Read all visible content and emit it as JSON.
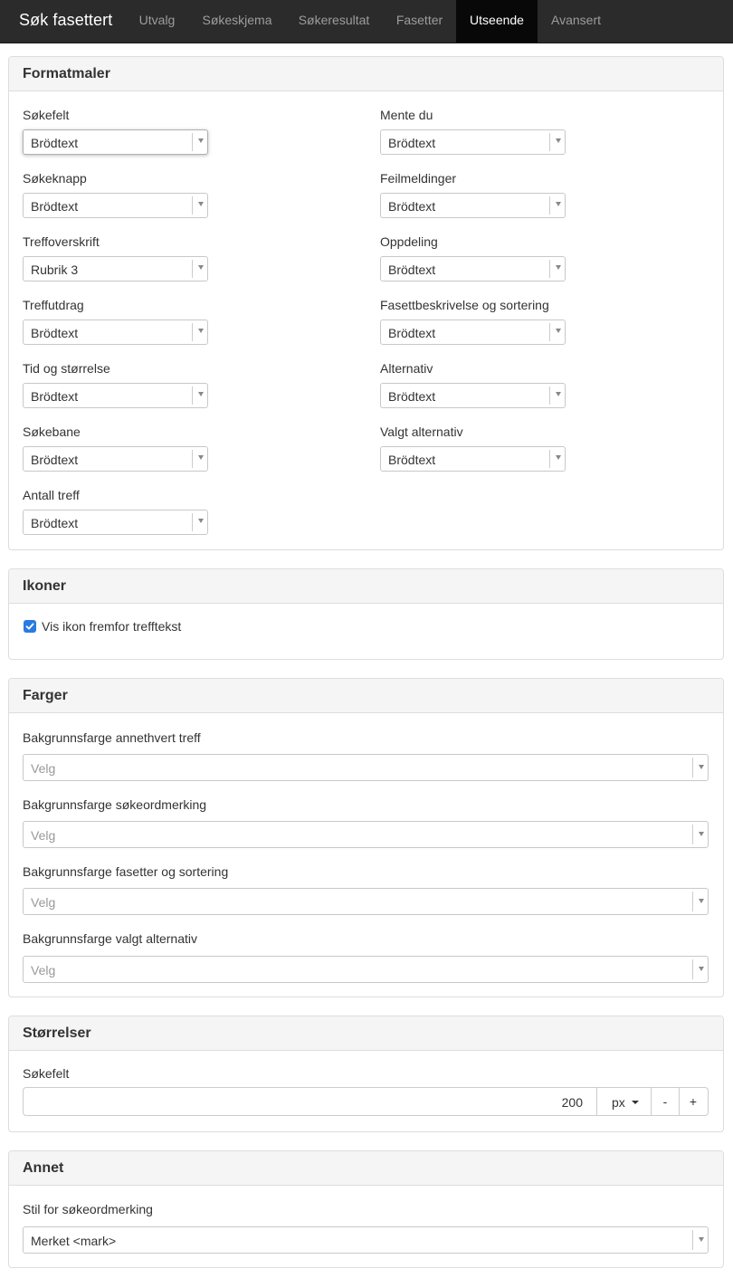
{
  "nav": {
    "brand": "Søk fasettert",
    "tabs": [
      {
        "label": "Utvalg"
      },
      {
        "label": "Søkeskjema"
      },
      {
        "label": "Søkeresultat"
      },
      {
        "label": "Fasetter"
      },
      {
        "label": "Utseende",
        "active": true
      },
      {
        "label": "Avansert"
      }
    ]
  },
  "formatmaler": {
    "title": "Formatmaler",
    "left": [
      {
        "label": "Søkefelt",
        "value": "Brödtext"
      },
      {
        "label": "Søkeknapp",
        "value": "Brödtext"
      },
      {
        "label": "Treffoverskrift",
        "value": "Rubrik 3"
      },
      {
        "label": "Treffutdrag",
        "value": "Brödtext"
      },
      {
        "label": "Tid og størrelse",
        "value": "Brödtext"
      },
      {
        "label": "Søkebane",
        "value": "Brödtext"
      },
      {
        "label": "Antall treff",
        "value": "Brödtext"
      }
    ],
    "right": [
      {
        "label": "Mente du",
        "value": "Brödtext"
      },
      {
        "label": "Feilmeldinger",
        "value": "Brödtext"
      },
      {
        "label": "Oppdeling",
        "value": "Brödtext"
      },
      {
        "label": "Fasettbeskrivelse og sortering",
        "value": "Brödtext"
      },
      {
        "label": "Alternativ",
        "value": "Brödtext"
      },
      {
        "label": "Valgt alternativ",
        "value": "Brödtext"
      }
    ]
  },
  "ikoner": {
    "title": "Ikoner",
    "checkbox_label": "Vis ikon fremfor trefftekst",
    "checked": true
  },
  "farger": {
    "title": "Farger",
    "fields": [
      {
        "label": "Bakgrunnsfarge annethvert treff",
        "placeholder": "Velg"
      },
      {
        "label": "Bakgrunnsfarge søkeordmerking",
        "placeholder": "Velg"
      },
      {
        "label": "Bakgrunnsfarge fasetter og sortering",
        "placeholder": "Velg"
      },
      {
        "label": "Bakgrunnsfarge valgt alternativ",
        "placeholder": "Velg"
      }
    ]
  },
  "storrelser": {
    "title": "Størrelser",
    "label": "Søkefelt",
    "value": "200",
    "unit": "px",
    "minus": "-",
    "plus": "+"
  },
  "annet": {
    "title": "Annet",
    "label": "Stil for søkeordmerking",
    "value": "Merket <mark>"
  },
  "colors": {
    "navbar_bg": "#2b2b2b",
    "active_tab_bg": "#080808",
    "checkbox": "#2a7ae2",
    "panel_heading": "#f5f5f5"
  }
}
